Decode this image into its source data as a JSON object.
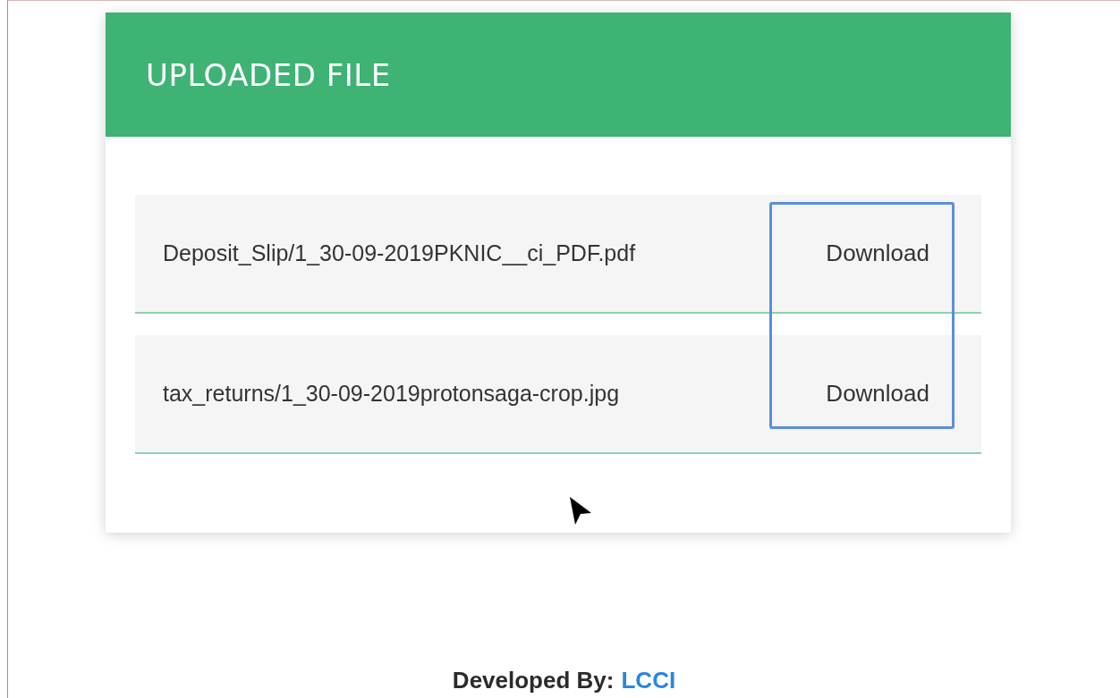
{
  "card": {
    "title": "UPLOADED FILE"
  },
  "files": [
    {
      "name": "Deposit_Slip/1_30-09-2019PKNIC__ci_PDF.pdf",
      "action": "Download"
    },
    {
      "name": "tax_returns/1_30-09-2019protonsaga-crop.jpg",
      "action": "Download"
    }
  ],
  "footer": {
    "label": "Developed By:",
    "link": "LCCI"
  }
}
